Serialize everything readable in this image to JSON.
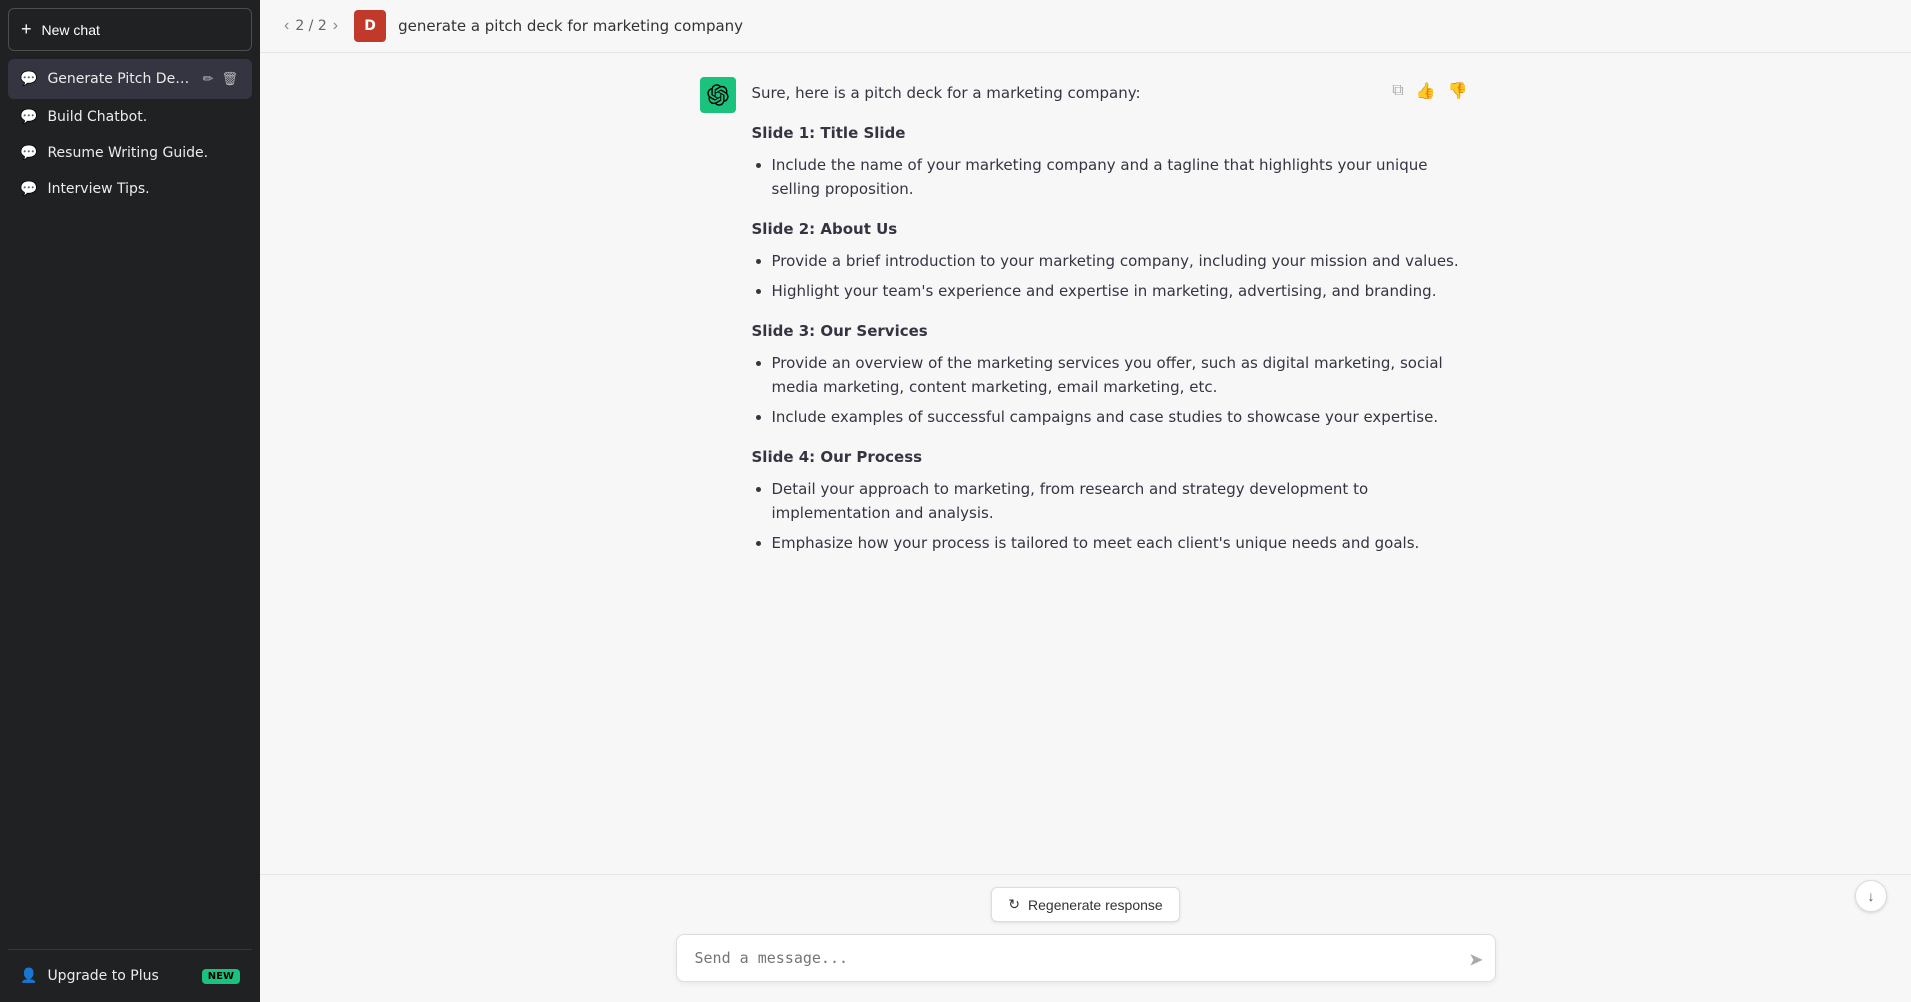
{
  "sidebar": {
    "new_chat_label": "New chat",
    "items": [
      {
        "id": "generate-pitch-deck",
        "label": "Generate Pitch Deck.",
        "active": true
      },
      {
        "id": "build-chatbot",
        "label": "Build Chatbot.",
        "active": false
      },
      {
        "id": "resume-writing-guide",
        "label": "Resume Writing Guide.",
        "active": false
      },
      {
        "id": "interview-tips",
        "label": "Interview Tips.",
        "active": false
      }
    ],
    "upgrade_label": "Upgrade to Plus",
    "upgrade_badge": "NEW"
  },
  "header": {
    "nav_count": "2 / 2",
    "user_initial": "D",
    "title": "generate a pitch deck for marketing company"
  },
  "message": {
    "intro": "Sure, here is a pitch deck for a marketing company:",
    "slides": [
      {
        "heading": "Slide 1: Title Slide",
        "bullets": [
          "Include the name of your marketing company and a tagline that highlights your unique selling proposition."
        ]
      },
      {
        "heading": "Slide 2: About Us",
        "bullets": [
          "Provide a brief introduction to your marketing company, including your mission and values.",
          "Highlight your team's experience and expertise in marketing, advertising, and branding."
        ]
      },
      {
        "heading": "Slide 3: Our Services",
        "bullets": [
          "Provide an overview of the marketing services you offer, such as digital marketing, social media marketing, content marketing, email marketing, etc.",
          "Include examples of successful campaigns and case studies to showcase your expertise."
        ]
      },
      {
        "heading": "Slide 4: Our Process",
        "bullets": [
          "Detail your approach to marketing, from research and strategy development to implementation and analysis.",
          "Emphasize how your process is tailored to meet each client's unique needs and goals."
        ]
      }
    ]
  },
  "input": {
    "placeholder": "Send a message..."
  },
  "regenerate_label": "Regenerate response",
  "icons": {
    "plus": "+",
    "chat_bubble": "💬",
    "user": "👤",
    "copy": "⧉",
    "thumbs_up": "👍",
    "thumbs_down": "👎",
    "send": "➤",
    "refresh": "↻",
    "scroll_down": "↓",
    "edit": "✏",
    "trash": "🗑",
    "chevron_left": "‹",
    "chevron_right": "›"
  }
}
